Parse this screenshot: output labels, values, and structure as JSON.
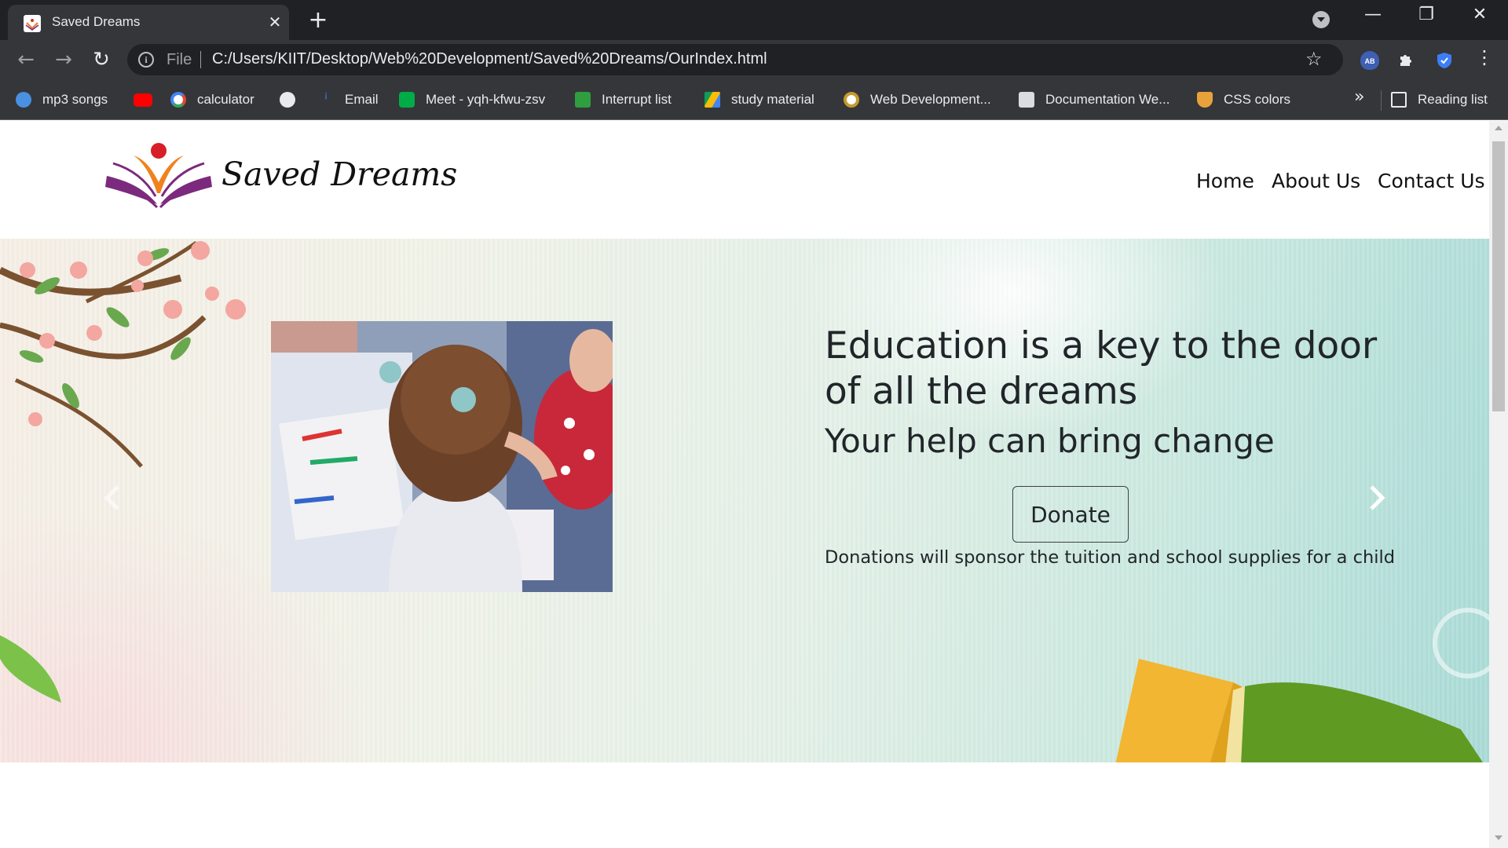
{
  "browser": {
    "tab_title": "Saved Dreams",
    "url_scheme": "File",
    "url": "C:/Users/KIIT/Desktop/Web%20Development/Saved%20Dreams/OurIndex.html",
    "bookmarks": [
      {
        "label": "mp3 songs",
        "icon": "cloud-music-icon",
        "color": "#4a90e2"
      },
      {
        "label": "",
        "icon": "youtube-icon",
        "color": "#ff0000"
      },
      {
        "label": "calculator",
        "icon": "google-icon",
        "color": "#ffffff"
      },
      {
        "label": "",
        "icon": "globe-icon",
        "color": "#e8eaed"
      },
      {
        "label": "Email",
        "icon": "email-icon",
        "color": "#3b82f6"
      },
      {
        "label": "Meet - yqh-kfwu-zsv",
        "icon": "meet-icon",
        "color": "#00ac47"
      },
      {
        "label": "Interrupt list",
        "icon": "interrupt-icon",
        "color": "#2e9e3e"
      },
      {
        "label": "study material",
        "icon": "drive-icon",
        "color": "#fbbc04"
      },
      {
        "label": "Web Development...",
        "icon": "web-dev-icon",
        "color": "#ffffff"
      },
      {
        "label": "Documentation We...",
        "icon": "documentation-icon",
        "color": "#dadce0"
      },
      {
        "label": "CSS colors",
        "icon": "css-icon",
        "color": "#e9a23b"
      }
    ],
    "more_bookmarks": "»",
    "reading_list": "Reading list"
  },
  "site": {
    "brand": "Saved Dreams",
    "nav": [
      "Home",
      "About Us",
      "Contact Us"
    ]
  },
  "hero": {
    "title": "Education is a key to the door of all the dreams",
    "subtitle": "Your help can bring change",
    "button": "Donate",
    "note": "Donations will sponsor the tuition and school supplies for a child"
  }
}
